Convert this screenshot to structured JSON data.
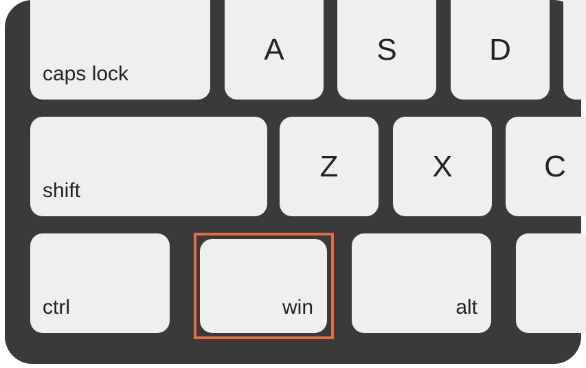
{
  "colors": {
    "panel_bg": "#3a3a3a",
    "key_bg": "#efefef",
    "highlight": "#ec6a3f"
  },
  "highlight_target": "win",
  "rows": [
    {
      "keys": [
        {
          "id": "capslock",
          "label": "caps lock",
          "align": "bottomleft"
        },
        {
          "id": "a",
          "label": "A",
          "align": "center"
        },
        {
          "id": "s",
          "label": "S",
          "align": "center"
        },
        {
          "id": "d",
          "label": "D",
          "align": "center"
        },
        {
          "id": "f",
          "label": "",
          "align": "center"
        }
      ]
    },
    {
      "keys": [
        {
          "id": "shift",
          "label": "shift",
          "align": "bottomleft"
        },
        {
          "id": "z",
          "label": "Z",
          "align": "center"
        },
        {
          "id": "x",
          "label": "X",
          "align": "center"
        },
        {
          "id": "c",
          "label": "C",
          "align": "center"
        }
      ]
    },
    {
      "keys": [
        {
          "id": "ctrl",
          "label": "ctrl",
          "align": "bottomleft"
        },
        {
          "id": "win",
          "label": "win",
          "align": "bottomright"
        },
        {
          "id": "alt",
          "label": "alt",
          "align": "bottomright"
        },
        {
          "id": "space",
          "label": "",
          "align": "center"
        }
      ]
    }
  ]
}
